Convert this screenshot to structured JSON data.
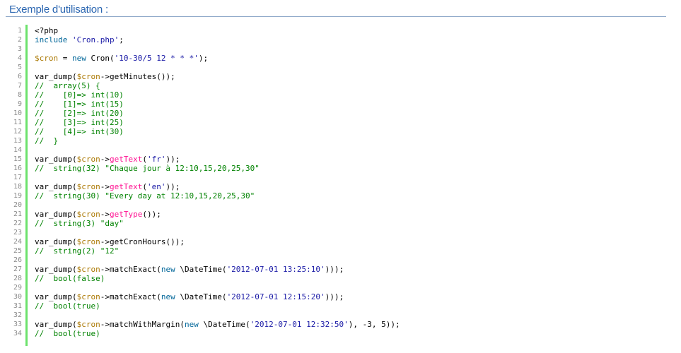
{
  "section": {
    "title": "Exemple d'utilisation :"
  },
  "colors": {
    "title": "#2b66b1",
    "gutter_bar": "#6ce26c",
    "keyword": "#006699",
    "string": "#1a1aa6",
    "variable": "#aa7700",
    "function": "#ff1493",
    "comment": "#008200"
  },
  "code": {
    "language": "php",
    "lines": [
      {
        "n": "1",
        "tokens": [
          {
            "t": "plain",
            "v": "<?php"
          }
        ]
      },
      {
        "n": "2",
        "tokens": [
          {
            "t": "kw",
            "v": "include"
          },
          {
            "t": "plain",
            "v": " "
          },
          {
            "t": "str",
            "v": "'Cron.php'"
          },
          {
            "t": "plain",
            "v": ";"
          }
        ]
      },
      {
        "n": "3",
        "tokens": []
      },
      {
        "n": "4",
        "tokens": [
          {
            "t": "var",
            "v": "$cron"
          },
          {
            "t": "plain",
            "v": " = "
          },
          {
            "t": "kw",
            "v": "new"
          },
          {
            "t": "plain",
            "v": " Cron("
          },
          {
            "t": "str",
            "v": "'10-30/5 12 * * *'"
          },
          {
            "t": "plain",
            "v": ");"
          }
        ]
      },
      {
        "n": "5",
        "tokens": []
      },
      {
        "n": "6",
        "tokens": [
          {
            "t": "plain",
            "v": "var_dump("
          },
          {
            "t": "var",
            "v": "$cron"
          },
          {
            "t": "plain",
            "v": "->getMinutes());"
          }
        ]
      },
      {
        "n": "7",
        "tokens": [
          {
            "t": "com",
            "v": "//  array(5) {"
          }
        ]
      },
      {
        "n": "8",
        "tokens": [
          {
            "t": "com",
            "v": "//    [0]=> int(10)"
          }
        ]
      },
      {
        "n": "9",
        "tokens": [
          {
            "t": "com",
            "v": "//    [1]=> int(15)"
          }
        ]
      },
      {
        "n": "10",
        "tokens": [
          {
            "t": "com",
            "v": "//    [2]=> int(20)"
          }
        ]
      },
      {
        "n": "11",
        "tokens": [
          {
            "t": "com",
            "v": "//    [3]=> int(25)"
          }
        ]
      },
      {
        "n": "12",
        "tokens": [
          {
            "t": "com",
            "v": "//    [4]=> int(30)"
          }
        ]
      },
      {
        "n": "13",
        "tokens": [
          {
            "t": "com",
            "v": "//  }"
          }
        ]
      },
      {
        "n": "14",
        "tokens": []
      },
      {
        "n": "15",
        "tokens": [
          {
            "t": "plain",
            "v": "var_dump("
          },
          {
            "t": "var",
            "v": "$cron"
          },
          {
            "t": "plain",
            "v": "->"
          },
          {
            "t": "fn",
            "v": "getText"
          },
          {
            "t": "plain",
            "v": "("
          },
          {
            "t": "str",
            "v": "'fr'"
          },
          {
            "t": "plain",
            "v": "));"
          }
        ]
      },
      {
        "n": "16",
        "tokens": [
          {
            "t": "com",
            "v": "//  string(32) \"Chaque jour à 12:10,15,20,25,30\""
          }
        ]
      },
      {
        "n": "17",
        "tokens": []
      },
      {
        "n": "18",
        "tokens": [
          {
            "t": "plain",
            "v": "var_dump("
          },
          {
            "t": "var",
            "v": "$cron"
          },
          {
            "t": "plain",
            "v": "->"
          },
          {
            "t": "fn",
            "v": "getText"
          },
          {
            "t": "plain",
            "v": "("
          },
          {
            "t": "str",
            "v": "'en'"
          },
          {
            "t": "plain",
            "v": "));"
          }
        ]
      },
      {
        "n": "19",
        "tokens": [
          {
            "t": "com",
            "v": "//  string(30) \"Every day at 12:10,15,20,25,30\""
          }
        ]
      },
      {
        "n": "20",
        "tokens": []
      },
      {
        "n": "21",
        "tokens": [
          {
            "t": "plain",
            "v": "var_dump("
          },
          {
            "t": "var",
            "v": "$cron"
          },
          {
            "t": "plain",
            "v": "->"
          },
          {
            "t": "fn",
            "v": "getType"
          },
          {
            "t": "plain",
            "v": "());"
          }
        ]
      },
      {
        "n": "22",
        "tokens": [
          {
            "t": "com",
            "v": "//  string(3) \"day\""
          }
        ]
      },
      {
        "n": "23",
        "tokens": []
      },
      {
        "n": "24",
        "tokens": [
          {
            "t": "plain",
            "v": "var_dump("
          },
          {
            "t": "var",
            "v": "$cron"
          },
          {
            "t": "plain",
            "v": "->getCronHours());"
          }
        ]
      },
      {
        "n": "25",
        "tokens": [
          {
            "t": "com",
            "v": "//  string(2) \"12\""
          }
        ]
      },
      {
        "n": "26",
        "tokens": []
      },
      {
        "n": "27",
        "tokens": [
          {
            "t": "plain",
            "v": "var_dump("
          },
          {
            "t": "var",
            "v": "$cron"
          },
          {
            "t": "plain",
            "v": "->matchExact("
          },
          {
            "t": "kw",
            "v": "new"
          },
          {
            "t": "plain",
            "v": " \\DateTime("
          },
          {
            "t": "str",
            "v": "'2012-07-01 13:25:10'"
          },
          {
            "t": "plain",
            "v": ")));"
          }
        ]
      },
      {
        "n": "28",
        "tokens": [
          {
            "t": "com",
            "v": "//  bool(false)"
          }
        ]
      },
      {
        "n": "29",
        "tokens": []
      },
      {
        "n": "30",
        "tokens": [
          {
            "t": "plain",
            "v": "var_dump("
          },
          {
            "t": "var",
            "v": "$cron"
          },
          {
            "t": "plain",
            "v": "->matchExact("
          },
          {
            "t": "kw",
            "v": "new"
          },
          {
            "t": "plain",
            "v": " \\DateTime("
          },
          {
            "t": "str",
            "v": "'2012-07-01 12:15:20'"
          },
          {
            "t": "plain",
            "v": ")));"
          }
        ]
      },
      {
        "n": "31",
        "tokens": [
          {
            "t": "com",
            "v": "//  bool(true)"
          }
        ]
      },
      {
        "n": "32",
        "tokens": []
      },
      {
        "n": "33",
        "tokens": [
          {
            "t": "plain",
            "v": "var_dump("
          },
          {
            "t": "var",
            "v": "$cron"
          },
          {
            "t": "plain",
            "v": "->matchWithMargin("
          },
          {
            "t": "kw",
            "v": "new"
          },
          {
            "t": "plain",
            "v": " \\DateTime("
          },
          {
            "t": "str",
            "v": "'2012-07-01 12:32:50'"
          },
          {
            "t": "plain",
            "v": "), -3, 5));"
          }
        ]
      },
      {
        "n": "34",
        "tokens": [
          {
            "t": "com",
            "v": "//  bool(true)"
          }
        ]
      }
    ]
  }
}
